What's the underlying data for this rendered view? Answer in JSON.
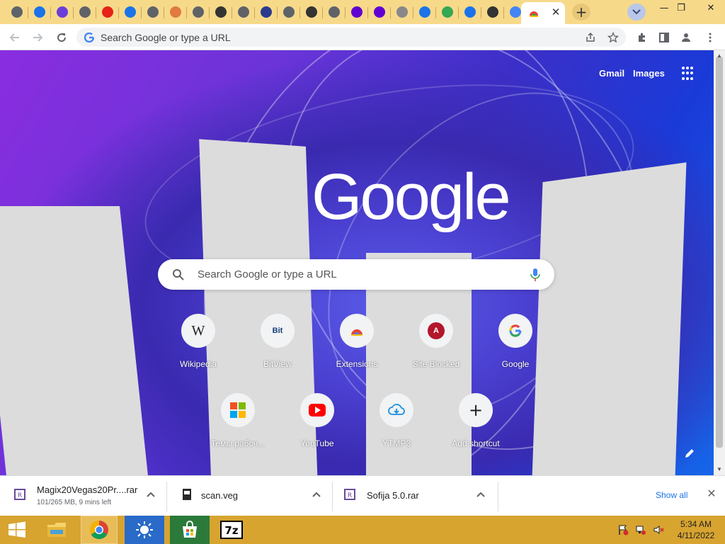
{
  "browser": {
    "tabs": [
      {
        "name": "chrome",
        "color": "#5f6368"
      },
      {
        "name": "mail-app",
        "color": "#1a73e8"
      },
      {
        "name": "u-letter",
        "color": "#6c3fd8"
      },
      {
        "name": "globe",
        "color": "#5f6368"
      },
      {
        "name": "youtube",
        "color": "#e62117"
      },
      {
        "name": "cloud-download",
        "color": "#1a73e8"
      },
      {
        "name": "globe",
        "color": "#5f6368"
      },
      {
        "name": "diamond",
        "color": "#e07a40"
      },
      {
        "name": "globe",
        "color": "#5f6368"
      },
      {
        "name": "stripe-logo",
        "color": "#333333"
      },
      {
        "name": "globe",
        "color": "#5f6368"
      },
      {
        "name": "keyboard",
        "color": "#2b3a8c"
      },
      {
        "name": "globe",
        "color": "#5f6368"
      },
      {
        "name": "soccer",
        "color": "#333333"
      },
      {
        "name": "globe",
        "color": "#5f6368"
      },
      {
        "name": "yahoo",
        "color": "#6001d2"
      },
      {
        "name": "yahoo",
        "color": "#6001d2"
      },
      {
        "name": "arrow",
        "color": "#888888"
      },
      {
        "name": "u-arrow",
        "color": "#1a73e8"
      },
      {
        "name": "cloud",
        "color": "#34a853"
      },
      {
        "name": "stack",
        "color": "#1a73e8"
      },
      {
        "name": "crescent",
        "color": "#333333"
      },
      {
        "name": "google",
        "color": "#4285f4"
      },
      {
        "name": "chrome-store",
        "color": "#ea4335"
      }
    ],
    "new_tab_symbol": "+",
    "close_symbol": "✕",
    "window_controls": {
      "minimize": "—",
      "maximize": "❐",
      "close": "✕"
    }
  },
  "toolbar": {
    "omnibox_placeholder": "Search Google or type a URL"
  },
  "ntp": {
    "header_links": {
      "gmail": "Gmail",
      "images": "Images"
    },
    "logo_text": "Google",
    "search_placeholder": "Search Google or type a URL",
    "shortcuts": [
      {
        "label": "Wikipedia",
        "glyph": "W",
        "icon": "wikipedia-icon"
      },
      {
        "label": "BitView",
        "glyph": "Bit",
        "icon": "bitview-icon"
      },
      {
        "label": "Extensions",
        "glyph": "",
        "icon": "extensions-icon"
      },
      {
        "label": "Site Blocked",
        "glyph": "A",
        "icon": "site-blocked-icon"
      },
      {
        "label": "Google",
        "glyph": "G",
        "icon": "google-icon"
      },
      {
        "label": "Темы рабоч...",
        "glyph": "",
        "icon": "microsoft-icon"
      },
      {
        "label": "YouTube",
        "glyph": "",
        "icon": "youtube-icon"
      },
      {
        "label": "YTMP3",
        "glyph": "",
        "icon": "cloud-download-icon"
      },
      {
        "label": "Add shortcut",
        "glyph": "+",
        "icon": "add-icon"
      }
    ]
  },
  "downloads": {
    "items": [
      {
        "name": "Magix20Vegas20Pr....rar",
        "status": "101/265 MB, 9 mins left"
      },
      {
        "name": "scan.veg",
        "status": ""
      },
      {
        "name": "Sofija 5.0.rar",
        "status": ""
      }
    ],
    "show_all": "Show all",
    "close_symbol": "✕"
  },
  "taskbar": {
    "time": "5:34 AM",
    "date": "4/11/2022",
    "apps": [
      "start",
      "file-explorer",
      "chrome",
      "weather",
      "store",
      "7zip"
    ]
  }
}
